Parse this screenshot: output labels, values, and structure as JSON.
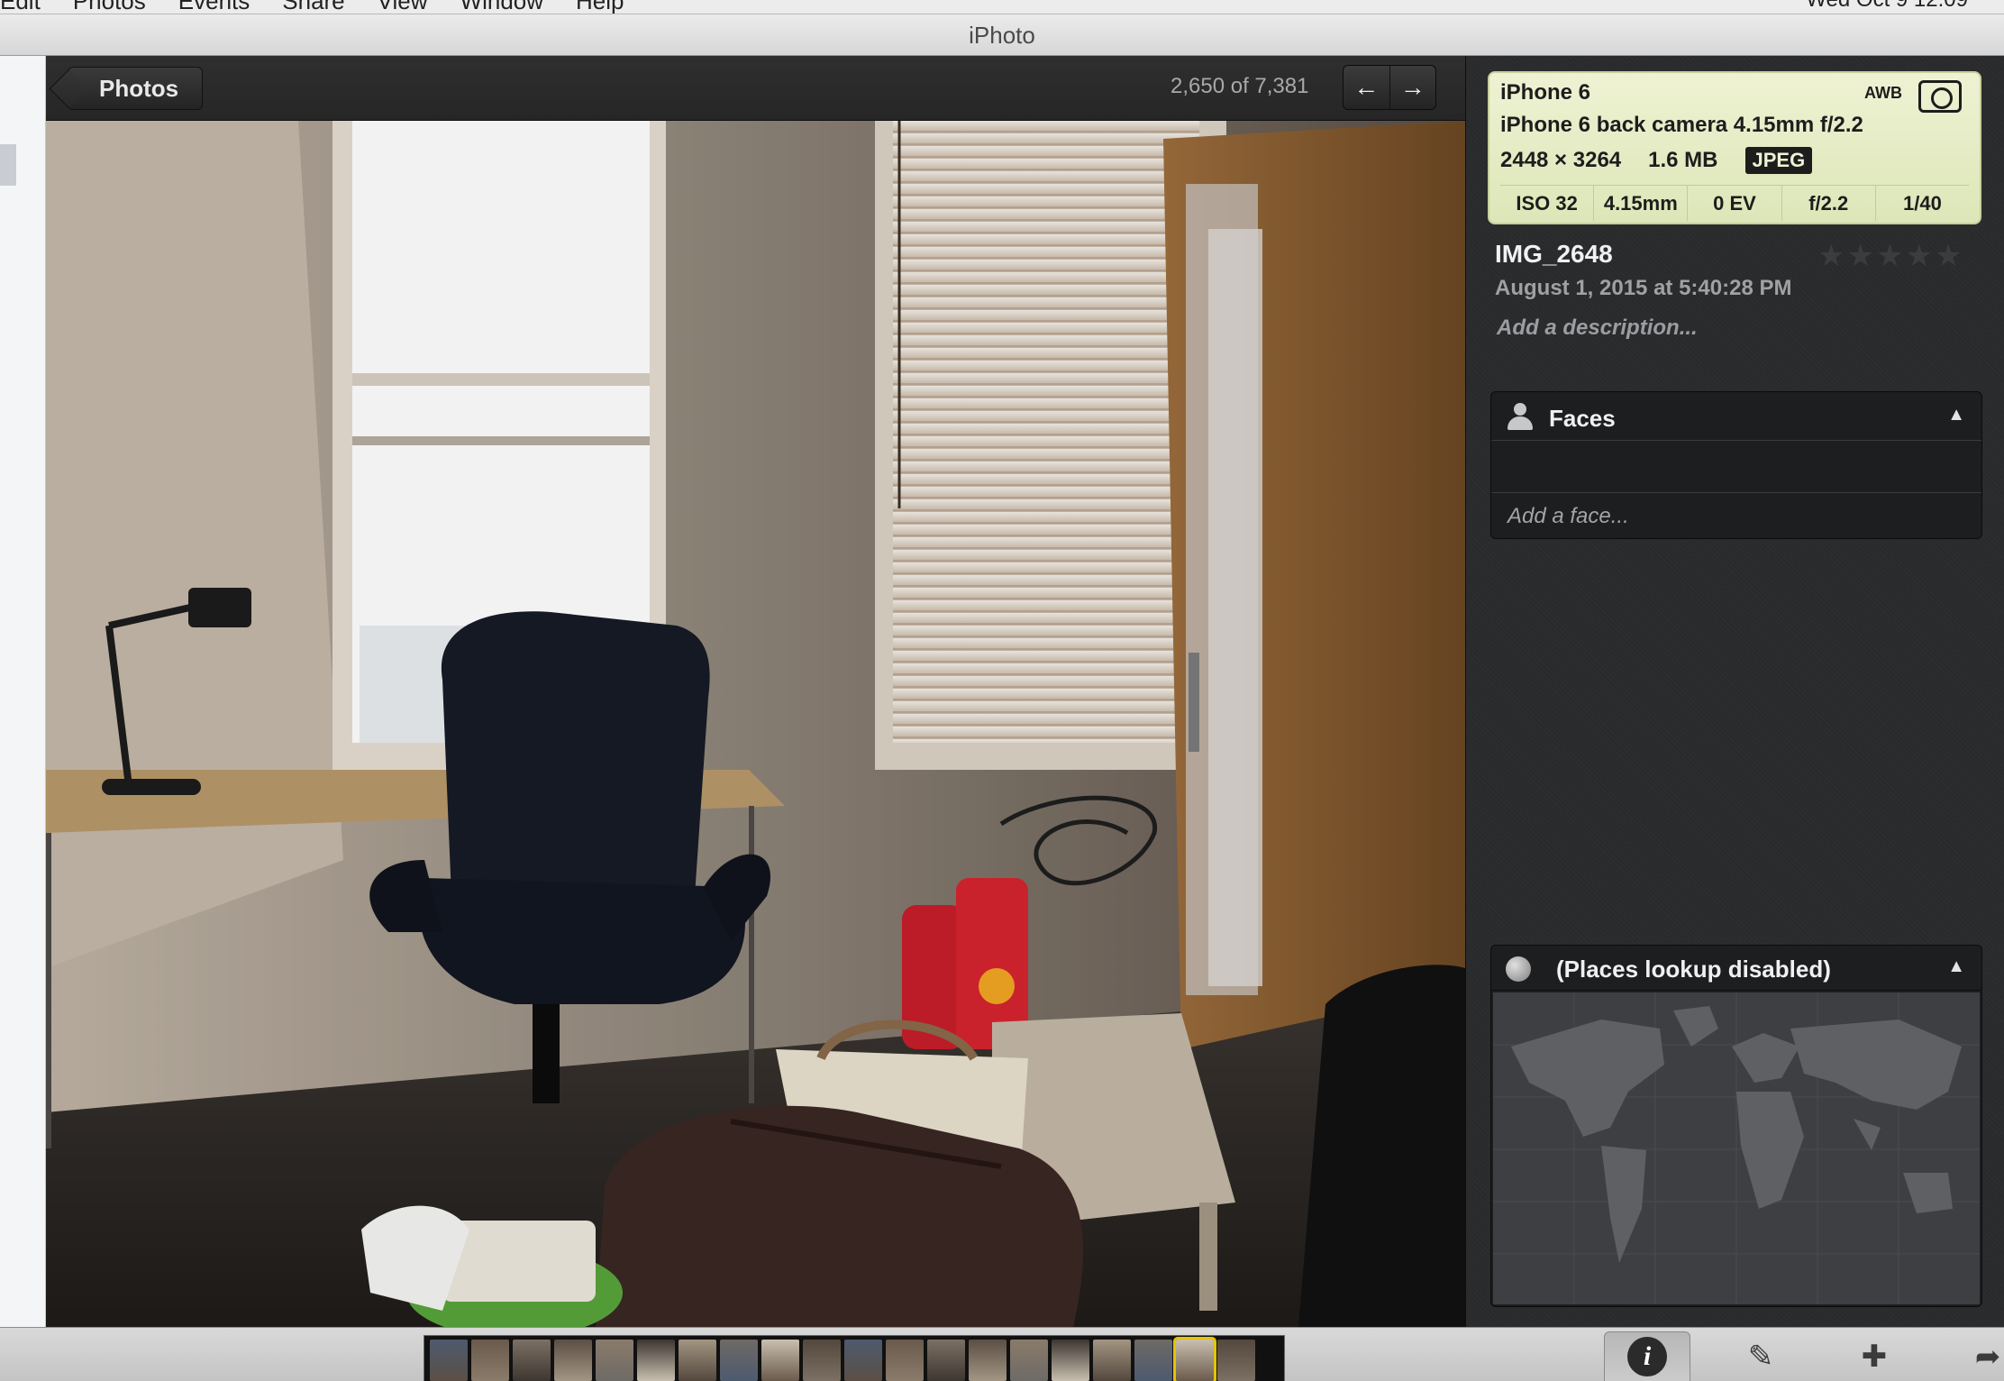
{
  "menubar": {
    "menus": [
      "Edit",
      "Photos",
      "Events",
      "Share",
      "View",
      "Window",
      "Help"
    ],
    "clock": "Wed Oct 9 12:09"
  },
  "window": {
    "title": "iPhoto"
  },
  "viewer": {
    "back_label": "Photos",
    "counter": "2,650 of 7,381",
    "prev_icon": "arrow-left-icon",
    "next_icon": "arrow-right-icon"
  },
  "info": {
    "camera": {
      "model": "iPhone 6",
      "awb": "AWB",
      "lens": "iPhone 6 back camera 4.15mm f/2.2",
      "dimensions": "2448 × 3264",
      "size": "1.6 MB",
      "format": "JPEG",
      "exif": [
        "ISO 32",
        "4.15mm",
        "0 EV",
        "f/2.2",
        "1/40"
      ]
    },
    "name": "IMG_2648",
    "rating": 0,
    "date": "August 1, 2015 at 5:40:28 PM",
    "description_placeholder": "Add a description...",
    "faces": {
      "title": "Faces",
      "add_placeholder": "Add a face..."
    },
    "places": {
      "title": "(Places lookup disabled)"
    }
  },
  "toolbar": {
    "tools": [
      {
        "name": "info-icon",
        "active": true
      },
      {
        "name": "edit-pencil-icon",
        "active": false
      },
      {
        "name": "add-to-icon",
        "active": false
      },
      {
        "name": "share-icon",
        "active": false
      }
    ]
  },
  "filmstrip": {
    "count": 20,
    "selected_index": 18
  },
  "colors": {
    "card": "#e6ecc6",
    "panel": "#2a2b2d",
    "selection": "#e5c400"
  }
}
